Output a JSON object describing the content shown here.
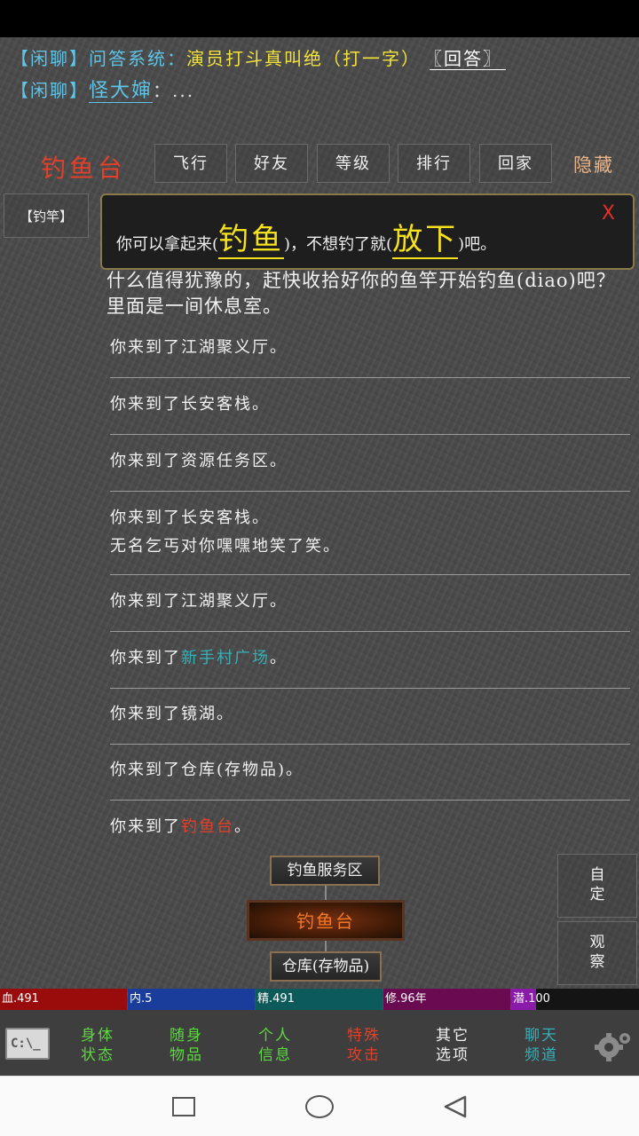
{
  "chat": {
    "line1": {
      "tag": "【闲聊】",
      "sender": "问答系统：",
      "message": "演员打斗真叫绝（打一字）",
      "answer": "〖回答〗"
    },
    "line2": {
      "tag": "【闲聊】",
      "sender": "怪大婶",
      "message": "：..."
    }
  },
  "room": {
    "title": "钓鱼台",
    "item_tag": "【钓竿】",
    "description": "什么值得犹豫的，赶快收拾好你的鱼竿开始钓鱼(diao)吧？ 里面是一间休息室。"
  },
  "top_buttons": [
    "飞行",
    "好友",
    "等级",
    "排行",
    "回家"
  ],
  "hide_label": "隐藏",
  "popup": {
    "prefix": "你可以拿起来(",
    "action1": "钓鱼",
    "middle": ")，不想钓了就(",
    "action2": "放下",
    "suffix": ")吧。",
    "close": "X"
  },
  "log": [
    {
      "text": "你来到了江湖聚义厅。"
    },
    {
      "text": "你来到了长安客栈。"
    },
    {
      "text": "你来到了资源任务区。"
    },
    {
      "text": "你来到了长安客栈。",
      "text2": "无名乞丐对你嘿嘿地笑了笑。"
    },
    {
      "text": "你来到了江湖聚义厅。"
    },
    {
      "prefix": "你来到了",
      "location": "新手村广场",
      "suffix": "。"
    },
    {
      "text": "你来到了镜湖。"
    },
    {
      "text": "你来到了仓库(存物品)。"
    },
    {
      "prefix": "你来到了",
      "location": "钓鱼台",
      "suffix": "。"
    }
  ],
  "map": {
    "north": "钓鱼服务区",
    "current": "钓鱼台",
    "south": "仓库(存物品)"
  },
  "side_buttons": {
    "custom": {
      "line1": "自",
      "line2": "定"
    },
    "observe": {
      "line1": "观",
      "line2": "察"
    }
  },
  "stats": {
    "blood": "血.491",
    "inner": "内.5",
    "spirit": "精.491",
    "cultivation": "修.96年",
    "potential": "潜.100"
  },
  "colors": {
    "blood": "#9a0c0c",
    "inner": "#1a3c9a",
    "spirit": "#0d5a5a",
    "cultivation": "#6a0a50",
    "potential": "#8a1aa8"
  },
  "bottom_nav": [
    {
      "line1": "身体",
      "line2": "状态",
      "color": "#5cd840"
    },
    {
      "line1": "随身",
      "line2": "物品",
      "color": "#5cd840"
    },
    {
      "line1": "个人",
      "line2": "信息",
      "color": "#5cd840"
    },
    {
      "line1": "特殊",
      "line2": "攻击",
      "color": "#e2402a"
    },
    {
      "line1": "其它",
      "line2": "选项",
      "color": "#f0f0f0"
    },
    {
      "line1": "聊天",
      "line2": "频道",
      "color": "#35b0b8"
    }
  ],
  "cmd_icon": "C:\\_"
}
